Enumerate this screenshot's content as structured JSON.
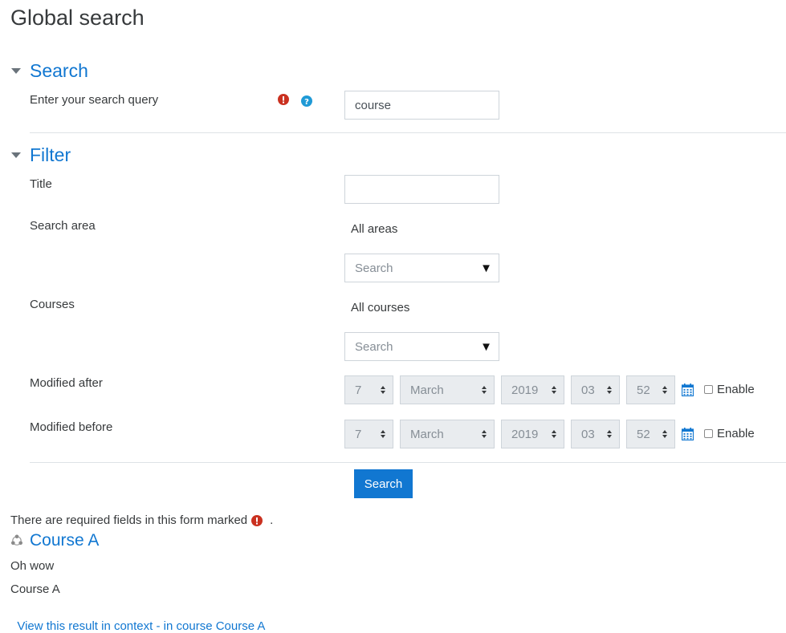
{
  "page": {
    "title": "Global search"
  },
  "search_section": {
    "legend": "Search",
    "query_label": "Enter your search query",
    "query_value": "course",
    "required_icon": "exclamation-circle-icon",
    "help_icon": "question-circle-icon"
  },
  "filter_section": {
    "legend": "Filter",
    "title_label": "Title",
    "title_value": "",
    "search_area_label": "Search area",
    "search_area_selection": "All areas",
    "search_area_placeholder": "Search",
    "courses_label": "Courses",
    "courses_selection": "All courses",
    "courses_placeholder": "Search",
    "modified_after": {
      "label": "Modified after",
      "day": "7",
      "month": "March",
      "year": "2019",
      "hour": "03",
      "minute": "52",
      "enable_label": "Enable",
      "enabled": false
    },
    "modified_before": {
      "label": "Modified before",
      "day": "7",
      "month": "March",
      "year": "2019",
      "hour": "03",
      "minute": "52",
      "enable_label": "Enable",
      "enabled": false
    }
  },
  "submit_label": "Search",
  "required_note": {
    "text": "There are required fields in this form marked",
    "suffix": "."
  },
  "result": {
    "title": "Course A",
    "content": "Oh wow",
    "course": "Course A",
    "view_link": "View this result in context",
    "separator": " - ",
    "course_link": "in course Course A",
    "icon": "course-icon"
  },
  "colors": {
    "link": "#1177d1",
    "required": "#ca3120",
    "help": "#1f9ad6"
  }
}
